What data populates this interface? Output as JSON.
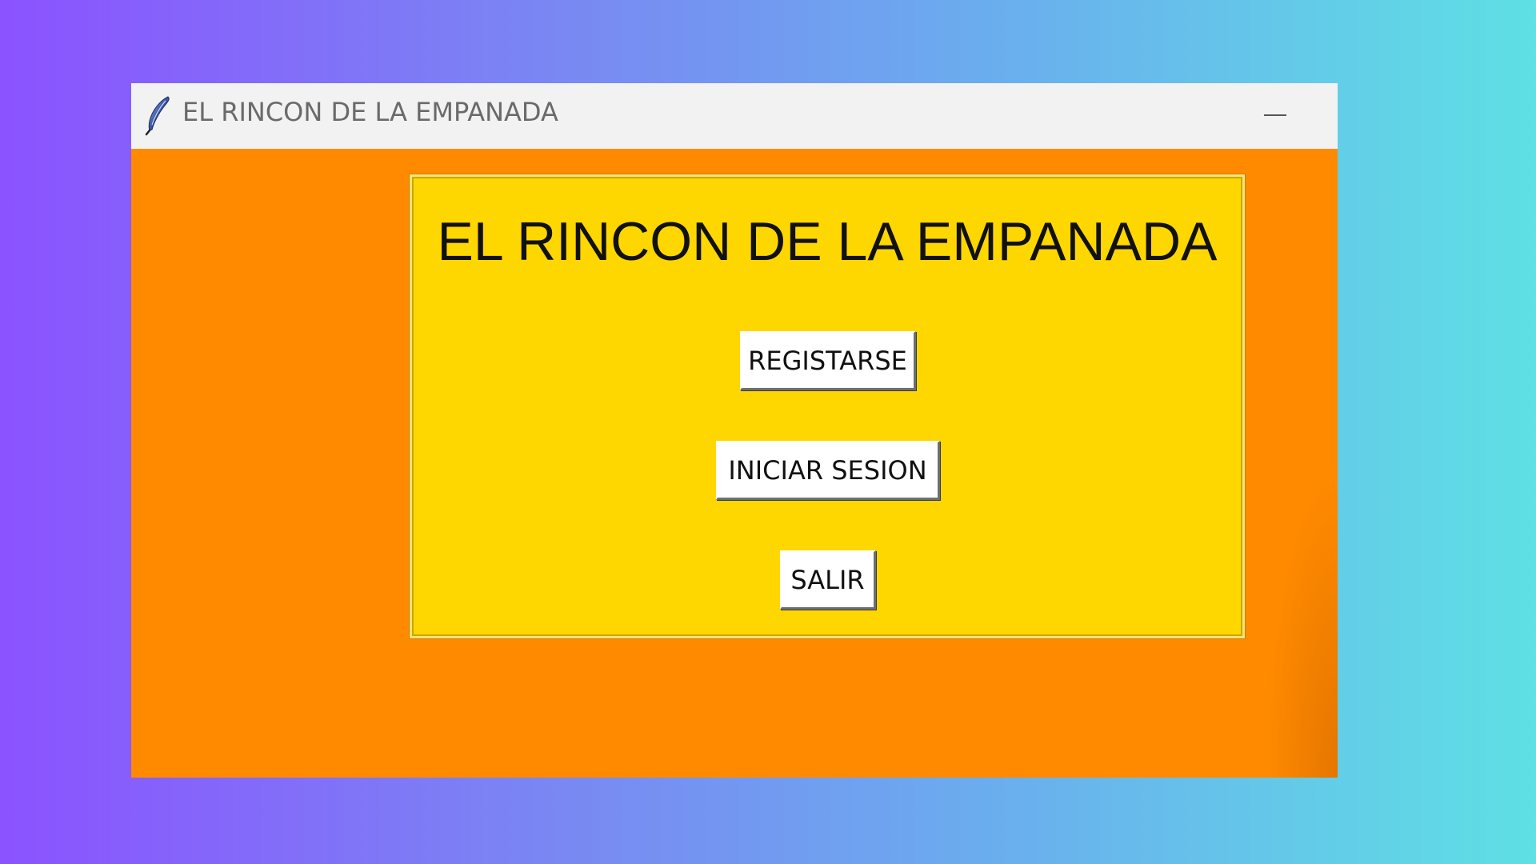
{
  "window": {
    "title": "EL RINCON DE LA EMPANADA",
    "icon": "feather-icon",
    "minimize_icon": "minimize-icon"
  },
  "main": {
    "heading": "EL RINCON DE LA EMPANADA",
    "buttons": {
      "register": "REGISTARSE",
      "login": "INICIAR SESION",
      "exit": "SALIR"
    }
  },
  "colors": {
    "window_background": "#ff8a00",
    "panel_background": "#ffd700",
    "button_background": "#ffffff",
    "titlebar_background": "#f2f2f2"
  }
}
